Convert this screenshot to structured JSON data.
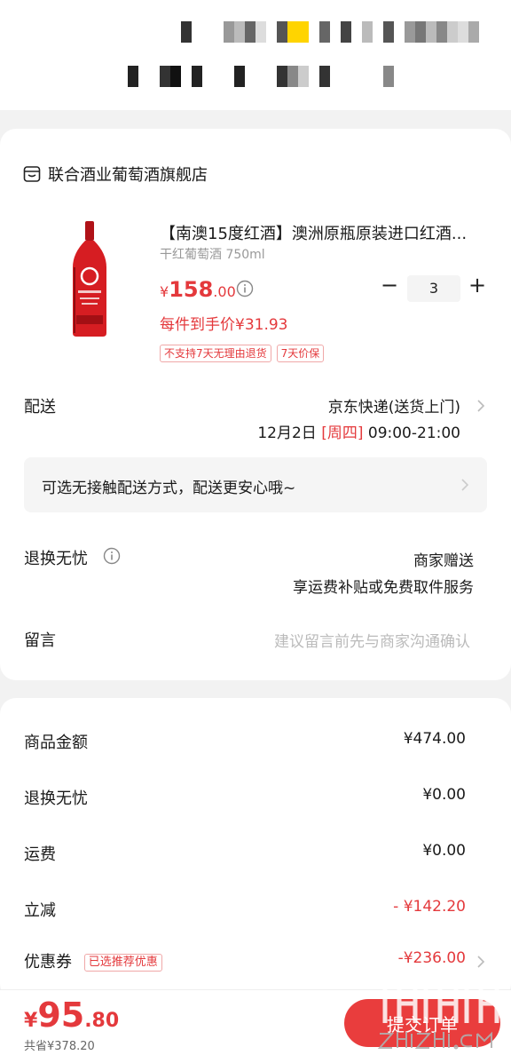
{
  "shop": {
    "name": "联合酒业葡萄酒旗舰店",
    "icon": "store-icon"
  },
  "product": {
    "title": "【南澳15度红酒】澳洲原瓶原装进口红酒...",
    "spec": "干红葡萄酒 750ml",
    "price_currency": "¥",
    "price_int": "158",
    "price_dec": ".00",
    "unit_price_text": "每件到手价¥31.93",
    "tags": [
      "不支持7天无理由退货",
      "7天价保"
    ],
    "quantity": "3",
    "minus_label": "−",
    "plus_label": "+"
  },
  "delivery": {
    "label": "配送",
    "method": "京东快递(送货上门)",
    "date": "12月2日",
    "weekday": "[周四]",
    "time": "09:00-21:00"
  },
  "contactless": {
    "text": "可选无接触配送方式，配送更安心哦~"
  },
  "worry_free": {
    "label": "退换无忧",
    "line1": "商家赠送",
    "line2": "享运费补贴或免费取件服务"
  },
  "message": {
    "label": "留言",
    "placeholder": "建议留言前先与商家沟通确认"
  },
  "fees": [
    {
      "label": "商品金额",
      "value": "¥474.00",
      "red": false
    },
    {
      "label": "退换无忧",
      "value": "¥0.00",
      "red": false
    },
    {
      "label": "运费",
      "value": "¥0.00",
      "red": false
    },
    {
      "label": "立减",
      "value": "- ¥142.20",
      "red": true
    }
  ],
  "coupon": {
    "label": "优惠券",
    "tag": "已选推荐优惠",
    "value": "-¥236.00"
  },
  "bottom": {
    "total_currency": "¥",
    "total_int": "95",
    "total_dec": ".80",
    "saved": "共省¥378.20",
    "submit_label": "提交订单"
  },
  "colors": {
    "accent": "#e4393c",
    "button": "#e93d3d",
    "background": "#f2f2f2"
  }
}
